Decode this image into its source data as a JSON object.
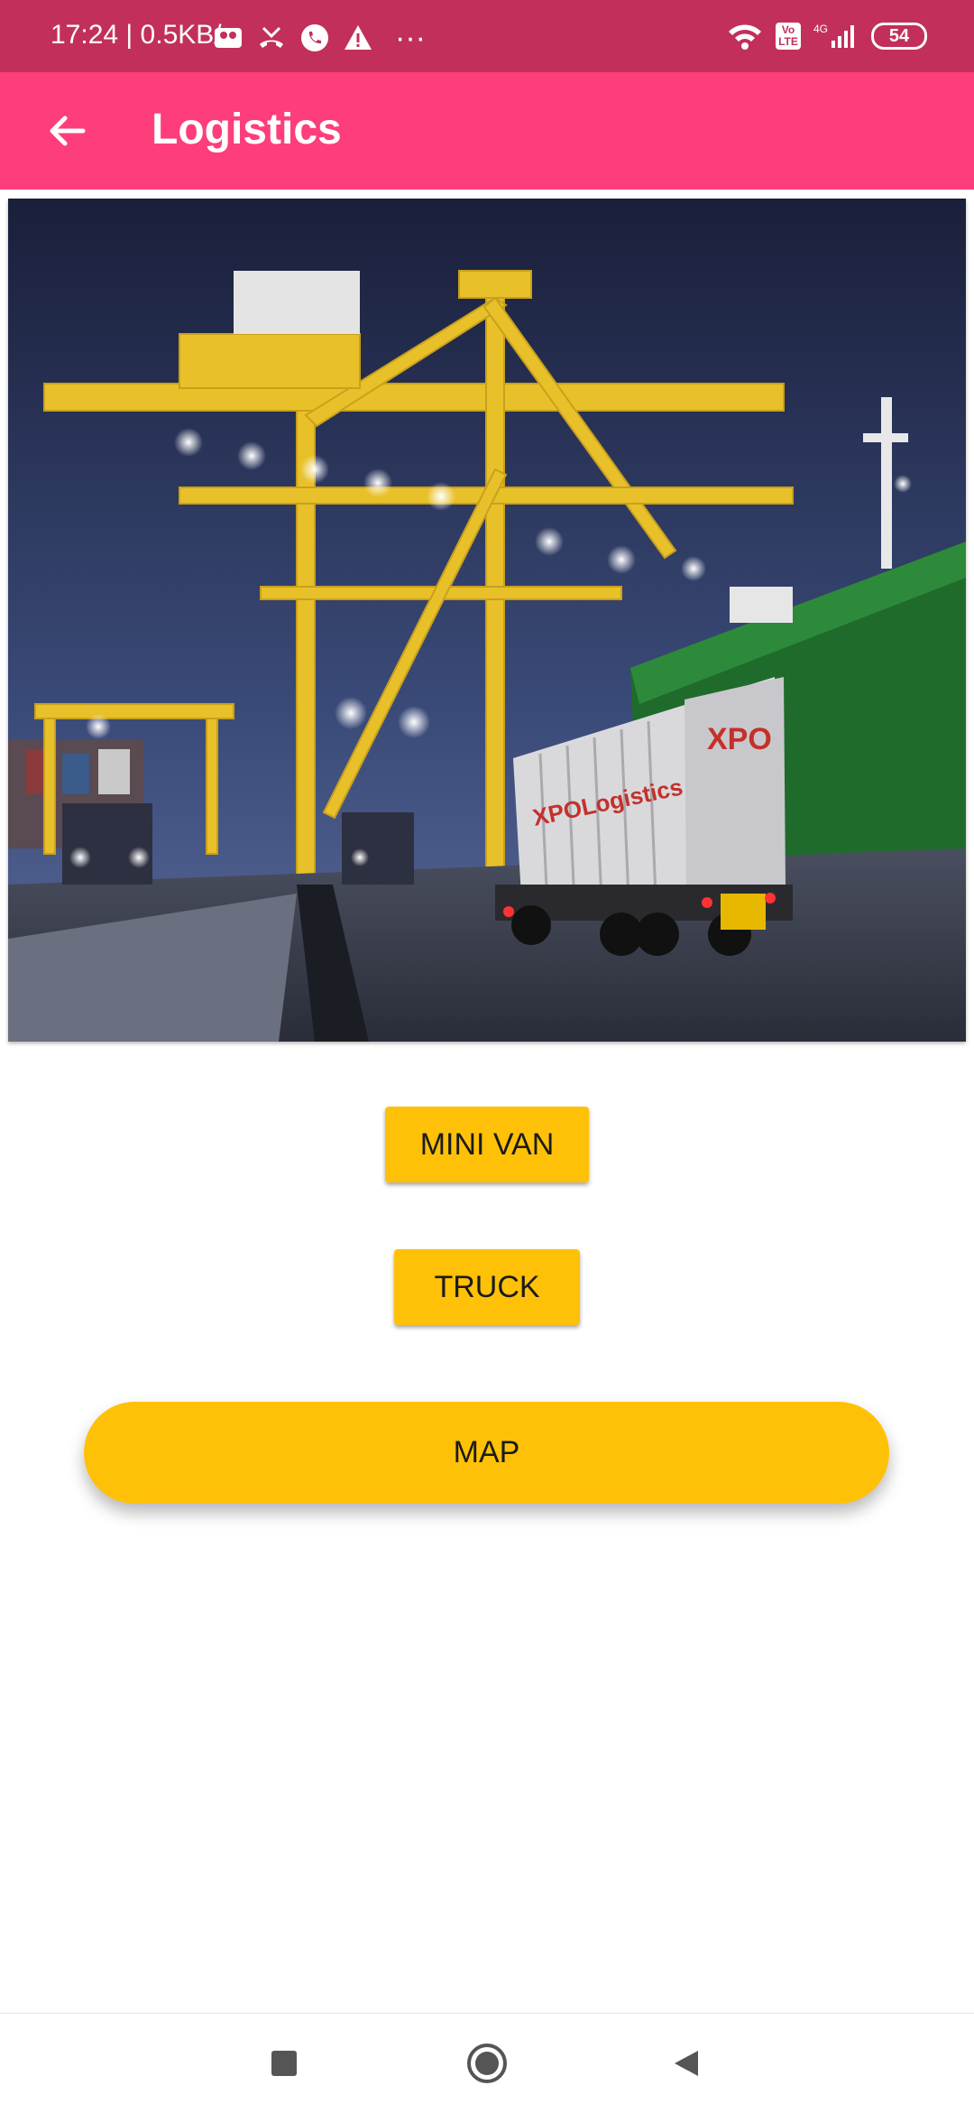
{
  "status_bar": {
    "time": "17:24",
    "net_speed": "0.5KB/s",
    "network_label": "4G",
    "volte_label": "Vo LTE",
    "battery": "54",
    "more": "···"
  },
  "app_bar": {
    "title": "Logistics"
  },
  "hero": {
    "logo_text": "XPO",
    "trailer_text": "XPOLogistics"
  },
  "buttons": {
    "mini_van": "MINI VAN",
    "truck": "TRUCK",
    "map": "MAP"
  },
  "colors": {
    "status_bar": "#c22f5b",
    "app_bar": "#fd3e7a",
    "button": "#ffc107"
  },
  "icons": {
    "back": "arrow-back-icon",
    "recents": "square-icon",
    "home": "circle-icon",
    "nav_back": "triangle-back-icon"
  }
}
